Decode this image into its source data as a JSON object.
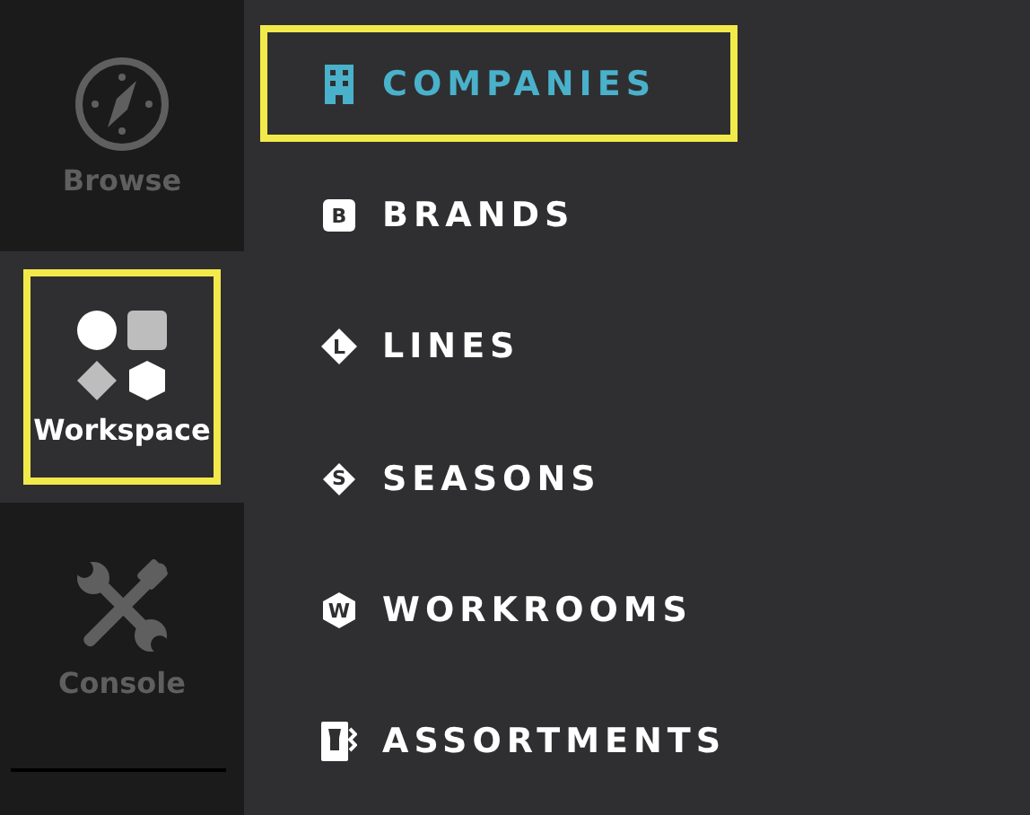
{
  "sidebar": {
    "items": [
      {
        "label": "Browse",
        "kind": "compass",
        "selected": false,
        "highlighted": false
      },
      {
        "label": "Workspace",
        "kind": "shapes",
        "selected": true,
        "highlighted": true
      },
      {
        "label": "Console",
        "kind": "tools",
        "selected": false,
        "highlighted": false
      }
    ]
  },
  "menu": {
    "items": [
      {
        "label": "COMPANIES",
        "kind": "building",
        "selected": true,
        "highlighted": true
      },
      {
        "label": "BRANDS",
        "kind": "square",
        "badge": "B",
        "selected": false,
        "highlighted": false
      },
      {
        "label": "LINES",
        "kind": "diamond",
        "badge": "L",
        "selected": false,
        "highlighted": false
      },
      {
        "label": "SEASONS",
        "kind": "rhombus",
        "badge": "S",
        "selected": false,
        "highlighted": false
      },
      {
        "label": "WORKROOMS",
        "kind": "hexagon",
        "badge": "W",
        "selected": false,
        "highlighted": false
      },
      {
        "label": "ASSORTMENTS",
        "kind": "assortment",
        "selected": false,
        "highlighted": false
      }
    ]
  }
}
